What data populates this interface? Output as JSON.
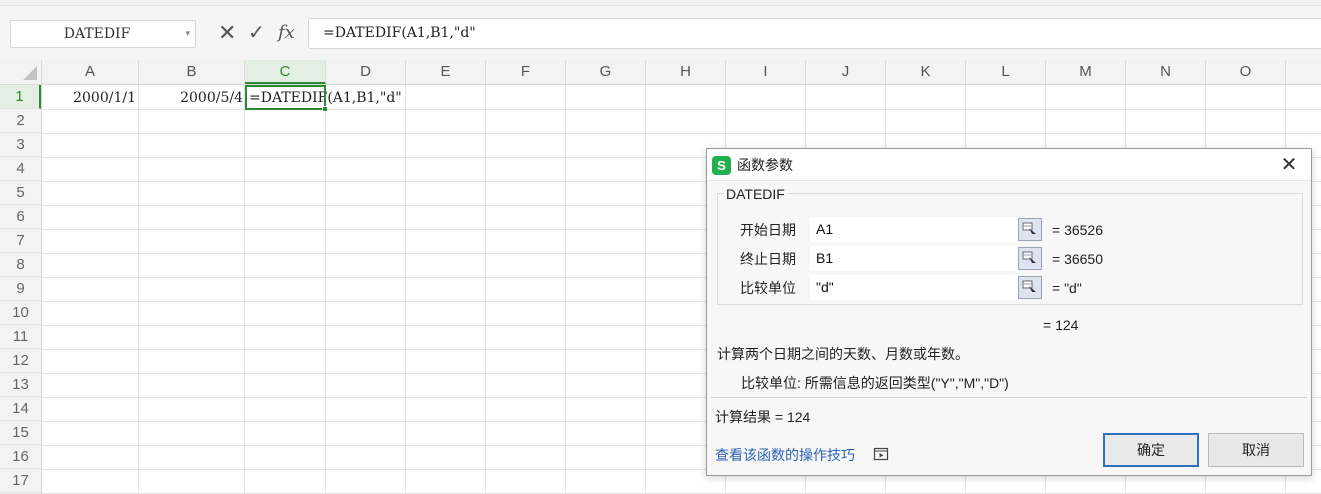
{
  "formula_bar": {
    "name_box": "DATEDIF",
    "name_box_arrow": "▾",
    "cancel_glyph": "✕",
    "enter_glyph": "✓",
    "fx_label": "fx",
    "formula": "=DATEDIF(A1,B1,\"d\""
  },
  "grid": {
    "columns": [
      "A",
      "B",
      "C",
      "D",
      "E",
      "F",
      "G",
      "H",
      "I",
      "J",
      "K",
      "L",
      "M",
      "N",
      "O"
    ],
    "active_column": "C",
    "rows": [
      "1",
      "2",
      "3",
      "4",
      "5",
      "6",
      "7",
      "8",
      "9",
      "10",
      "11",
      "12",
      "13",
      "14",
      "15",
      "16",
      "17"
    ],
    "active_row": "1",
    "cells": {
      "A1": "2000/1/1",
      "B1": "2000/5/4",
      "C1": "=DATEDIF(A1,B1,\"d\""
    }
  },
  "dialog": {
    "logo": "S",
    "title": "函数参数",
    "close_glyph": "✕",
    "function_name": "DATEDIF",
    "args": [
      {
        "label": "开始日期",
        "value": "A1",
        "result": "= 36526"
      },
      {
        "label": "终止日期",
        "value": "B1",
        "result": "= 36650"
      },
      {
        "label": "比较单位",
        "value": "\"d\"",
        "result": "= \"d\""
      }
    ],
    "formula_result": "= 124",
    "description": "计算两个日期之间的天数、月数或年数。",
    "param_description": "比较单位:  所需信息的返回类型(\"Y\",\"M\",\"D\")",
    "calc_result": "计算结果 = 124",
    "help_link": "查看该函数的操作技巧",
    "ok_label": "确定",
    "cancel_label": "取消",
    "accent": "#2c8a33",
    "logo_color": "#21b04b",
    "link_color": "#2b63b8"
  }
}
